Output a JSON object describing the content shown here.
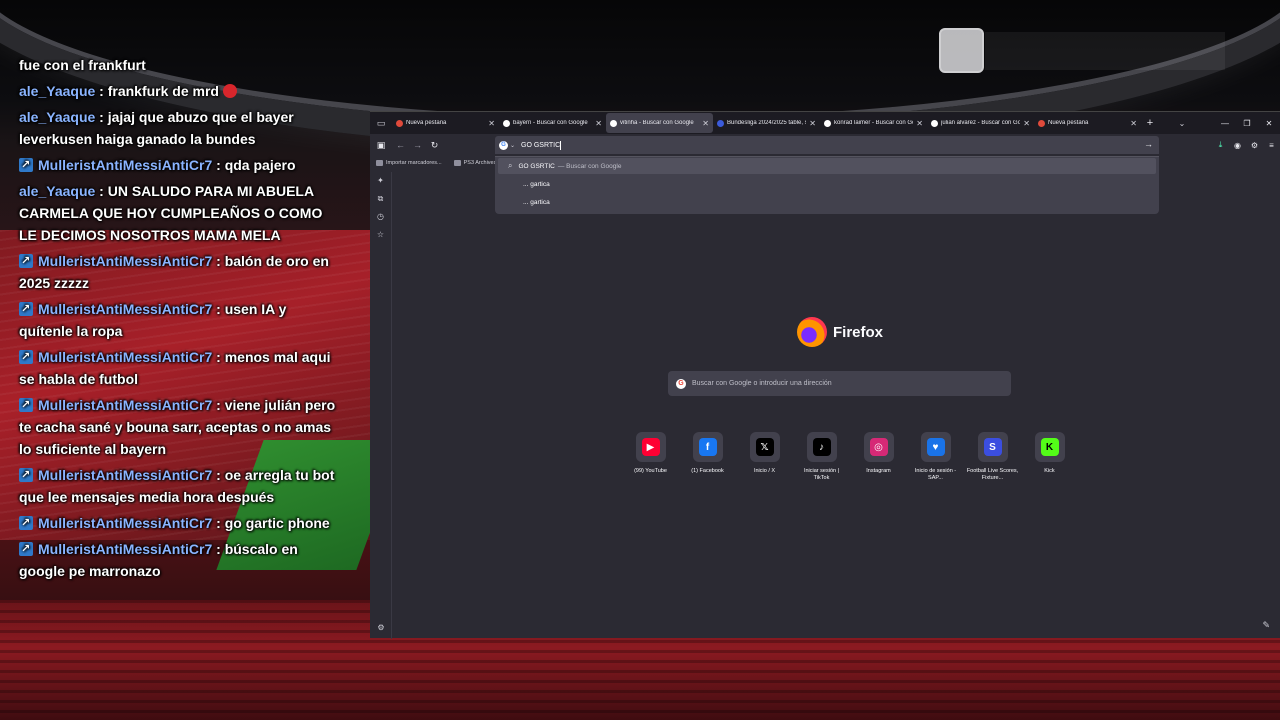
{
  "chat": [
    {
      "user": "",
      "text": "fue con el frankfurt",
      "badge": false
    },
    {
      "user": "ale_Yaaque",
      "text": "frankfurk de mrd",
      "badge": false,
      "emoji": "angry-emoji"
    },
    {
      "user": "ale_Yaaque",
      "text": "jajaj que abuzo que el bayer leverkusen haiga ganado la bundes",
      "badge": false
    },
    {
      "user": "MulleristAntiMessiAntiCr7",
      "text": "qda pajero",
      "badge": true
    },
    {
      "user": "ale_Yaaque",
      "text": "UN SALUDO PARA MI ABUELA CARMELA QUE HOY CUMPLEAÑOS O COMO LE DECIMOS NOSOTROS MAMA MELA",
      "badge": false
    },
    {
      "user": "MulleristAntiMessiAntiCr7",
      "text": "balón de oro en 2025 zzzzz",
      "badge": true
    },
    {
      "user": "MulleristAntiMessiAntiCr7",
      "text": "usen IA y quítenle la ropa",
      "badge": true
    },
    {
      "user": "MulleristAntiMessiAntiCr7",
      "text": "menos mal aqui se habla de futbol",
      "badge": true
    },
    {
      "user": "MulleristAntiMessiAntiCr7",
      "text": "viene julián pero te cacha sané y bouna sarr, aceptas o no amas lo suficiente al bayern",
      "badge": true
    },
    {
      "user": "MulleristAntiMessiAntiCr7",
      "text": "oe arregla tu bot que lee mensajes media hora después",
      "badge": true
    },
    {
      "user": "MulleristAntiMessiAntiCr7",
      "text": "go gartic phone",
      "badge": true
    },
    {
      "user": "MulleristAntiMessiAntiCr7",
      "text": "búscalo en google pe marronazo",
      "badge": true
    }
  ],
  "tabs": [
    {
      "label": "Nueva pestaña",
      "fav": "#e04a3b",
      "active": false
    },
    {
      "label": "bayern - Buscar con Google",
      "fav": "#ffffff",
      "active": false
    },
    {
      "label": "vitinha - Buscar con Google",
      "fav": "#ffffff",
      "active": true
    },
    {
      "label": "Bundesliga 2024/2025 table, sc",
      "fav": "#3b5bdb",
      "active": false
    },
    {
      "label": "konrad laimer - Buscar con Go",
      "fav": "#ffffff",
      "active": false
    },
    {
      "label": "julian alvarez - Buscar con Go",
      "fav": "#ffffff",
      "active": false
    },
    {
      "label": "Nueva pestaña",
      "fav": "#e04a3b",
      "active": false
    }
  ],
  "urlbar": {
    "value": "GO GSRTIC"
  },
  "dropdown": {
    "first": {
      "query": "GO GSRTIC",
      "suffix": "— Buscar con Google"
    },
    "suggestions": [
      "... gartica",
      "... gartica"
    ]
  },
  "bookmarks": [
    "Importar marcadores...",
    "PS3 Archives ..."
  ],
  "brand": {
    "name": "Firefox"
  },
  "search": {
    "placeholder": "Buscar con Google o introducir una dirección"
  },
  "shortcuts": [
    {
      "label": "(99) YouTube",
      "icon": "youtube-icon",
      "bg": "#ff0033",
      "glyph": "▶"
    },
    {
      "label": "(1) Facebook",
      "icon": "facebook-icon",
      "bg": "#1877f2",
      "glyph": "f"
    },
    {
      "label": "Inicio / X",
      "icon": "x-icon",
      "bg": "#000000",
      "glyph": "𝕏"
    },
    {
      "label": "Iniciar sesión | TikTok",
      "icon": "tiktok-icon",
      "bg": "#000000",
      "glyph": "♪"
    },
    {
      "label": "Instagram",
      "icon": "instagram-icon",
      "bg": "#d62976",
      "glyph": "◎"
    },
    {
      "label": "Inicio de sesión - SAP...",
      "icon": "sap-icon",
      "bg": "#1a73e8",
      "glyph": "♥"
    },
    {
      "label": "Football Live Scores, Fixture...",
      "icon": "football-icon",
      "bg": "#3b4ee0",
      "glyph": "S"
    },
    {
      "label": "Kick",
      "icon": "kick-icon",
      "bg": "#53fc18",
      "glyph": "K"
    }
  ]
}
